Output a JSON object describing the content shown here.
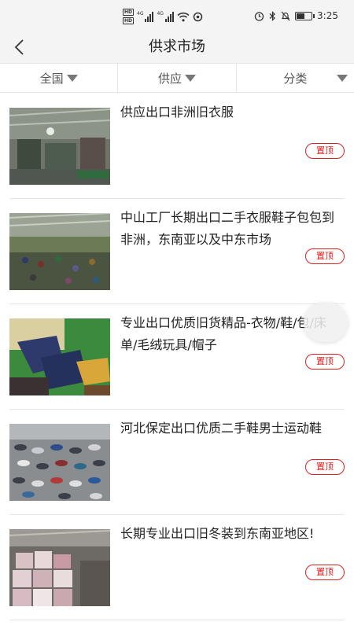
{
  "status_bar": {
    "hd_badges": [
      "HD",
      "HD"
    ],
    "network": [
      "4G",
      "4G"
    ],
    "time": "3:25",
    "battery_level": 0.6
  },
  "header": {
    "title": "供求市场",
    "back_icon": "chevron-left-icon"
  },
  "filters": [
    {
      "label": "全国",
      "icon": "caret-down-icon"
    },
    {
      "label": "供应",
      "icon": "caret-down-icon"
    },
    {
      "label": "分类",
      "icon": "caret-down-icon"
    }
  ],
  "items": [
    {
      "title": "供应出口非洲旧衣服",
      "badge": "置顶"
    },
    {
      "title": "中山工厂长期出口二手衣服鞋子包包到非洲，东南亚以及中东市场",
      "badge": "置顶"
    },
    {
      "title": "专业出口优质旧货精品-衣物/鞋/包/床单/毛绒玩具/帽子",
      "badge": "置顶"
    },
    {
      "title": "河北保定出口优质二手鞋男士运动鞋",
      "badge": "置顶"
    },
    {
      "title": "长期专业出口旧冬装到东南亚地区!",
      "badge": "置顶"
    }
  ],
  "colors": {
    "accent": "#e02020",
    "nav_background": "#f4f4f4"
  }
}
